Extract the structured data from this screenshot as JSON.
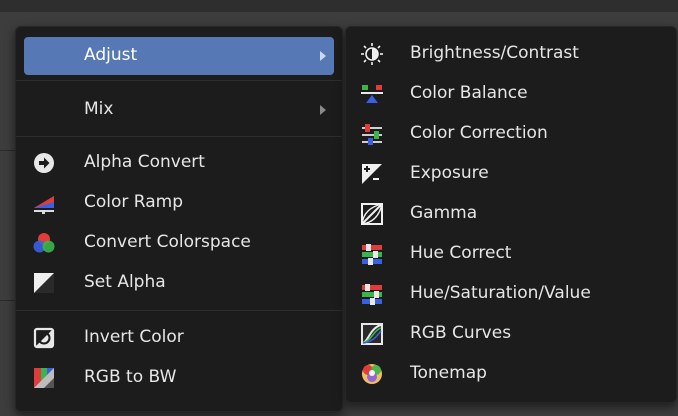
{
  "left_menu": {
    "adjust_label": "Adjust",
    "mix_label": "Mix",
    "items": [
      {
        "label": "Alpha Convert",
        "icon": "alpha-convert-icon"
      },
      {
        "label": "Color Ramp",
        "icon": "color-ramp-icon"
      },
      {
        "label": "Convert Colorspace",
        "icon": "convert-colorspace-icon"
      },
      {
        "label": "Set Alpha",
        "icon": "set-alpha-icon"
      },
      {
        "label": "Invert Color",
        "icon": "invert-color-icon"
      },
      {
        "label": "RGB to BW",
        "icon": "rgb-to-bw-icon"
      }
    ]
  },
  "right_menu": {
    "items": [
      {
        "label": "Brightness/Contrast",
        "icon": "brightness-contrast-icon"
      },
      {
        "label": "Color Balance",
        "icon": "color-balance-icon"
      },
      {
        "label": "Color Correction",
        "icon": "color-correction-icon"
      },
      {
        "label": "Exposure",
        "icon": "exposure-icon"
      },
      {
        "label": "Gamma",
        "icon": "gamma-icon"
      },
      {
        "label": "Hue Correct",
        "icon": "hue-correct-icon"
      },
      {
        "label": "Hue/Saturation/Value",
        "icon": "hue-saturation-value-icon"
      },
      {
        "label": "RGB Curves",
        "icon": "rgb-curves-icon"
      },
      {
        "label": "Tonemap",
        "icon": "tonemap-icon"
      }
    ]
  },
  "colors": {
    "menu_bg": "#1c1c1c",
    "highlight": "#5679b6",
    "text": "#e6e6e6"
  }
}
